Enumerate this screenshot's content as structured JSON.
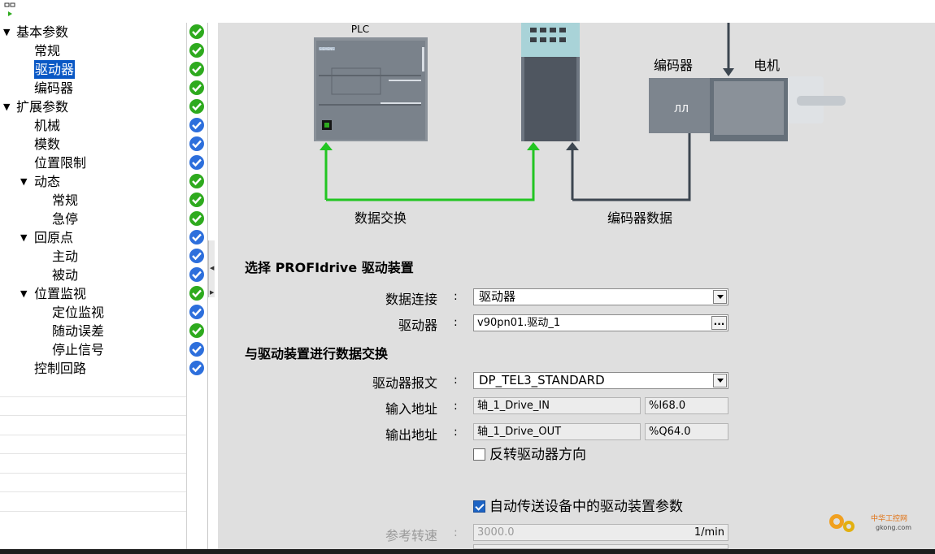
{
  "tree": {
    "items": [
      {
        "label": "基本参数",
        "level": 0,
        "expanded": true,
        "status": "ok",
        "selected": false
      },
      {
        "label": "常规",
        "level": 1,
        "status": "ok",
        "selected": false
      },
      {
        "label": "驱动器",
        "level": 1,
        "status": "ok",
        "selected": true
      },
      {
        "label": "编码器",
        "level": 1,
        "status": "ok",
        "selected": false
      },
      {
        "label": "扩展参数",
        "level": 0,
        "expanded": true,
        "status": "ok",
        "selected": false
      },
      {
        "label": "机械",
        "level": 1,
        "status": "info",
        "selected": false
      },
      {
        "label": "模数",
        "level": 1,
        "status": "info",
        "selected": false
      },
      {
        "label": "位置限制",
        "level": 1,
        "status": "info",
        "selected": false
      },
      {
        "label": "动态",
        "level": 1,
        "expanded": true,
        "status": "ok",
        "selected": false
      },
      {
        "label": "常规",
        "level": 2,
        "status": "ok",
        "selected": false
      },
      {
        "label": "急停",
        "level": 2,
        "status": "ok",
        "selected": false
      },
      {
        "label": "回原点",
        "level": 1,
        "expanded": true,
        "status": "info",
        "selected": false
      },
      {
        "label": "主动",
        "level": 2,
        "status": "info",
        "selected": false
      },
      {
        "label": "被动",
        "level": 2,
        "status": "info",
        "selected": false
      },
      {
        "label": "位置监视",
        "level": 1,
        "expanded": true,
        "status": "ok",
        "selected": false
      },
      {
        "label": "定位监视",
        "level": 2,
        "status": "info",
        "selected": false
      },
      {
        "label": "随动误差",
        "level": 2,
        "status": "ok",
        "selected": false
      },
      {
        "label": "停止信号",
        "level": 2,
        "status": "info",
        "selected": false
      },
      {
        "label": "控制回路",
        "level": 1,
        "status": "info",
        "selected": false
      }
    ]
  },
  "diagram": {
    "plc_label": "PLC",
    "encoder_label": "编码器",
    "motor_label": "电机",
    "data_exchange_label": "数据交换",
    "encoder_data_label": "编码器数据",
    "plc_brand": "SIEMENS",
    "encoder_symbol": "ЛЛ"
  },
  "form": {
    "section_select": "选择 PROFIdrive 驱动装置",
    "data_connection_label": "数据连接",
    "data_connection_value": "驱动器",
    "drive_label": "驱动器",
    "drive_value": "v90pn01.驱动_1",
    "drive_more": "...",
    "section_exchange": "与驱动装置进行数据交换",
    "telegram_label": "驱动器报文",
    "telegram_value": "DP_TEL3_STANDARD",
    "input_addr_label": "输入地址",
    "input_addr_tag": "轴_1_Drive_IN",
    "input_addr_value": "%I68.0",
    "output_addr_label": "输出地址",
    "output_addr_tag": "轴_1_Drive_OUT",
    "output_addr_value": "%Q64.0",
    "invert_dir_label": "反转驱动器方向",
    "invert_dir_checked": false,
    "auto_transfer_label": "自动传送设备中的驱动装置参数",
    "auto_transfer_checked": true,
    "ref_speed_label": "参考转速",
    "ref_speed_value": "3000.0",
    "ref_speed_unit": "1/min",
    "colon": ":"
  },
  "watermark": {
    "site": "gkong.com",
    "brand": "中华工控网"
  },
  "colors": {
    "ok": "#2eaa1e",
    "info": "#2d6fdc",
    "selection": "#0a58c5",
    "link_green": "#22c522",
    "link_dark": "#3c4650"
  }
}
